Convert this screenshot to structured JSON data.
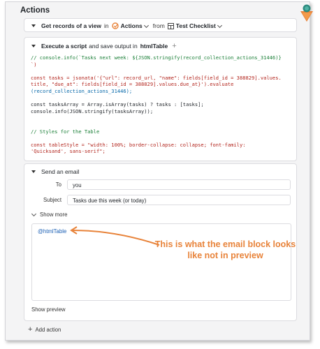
{
  "section_title": "Actions",
  "get_records": {
    "prefix": "Get records of a view",
    "in": "in",
    "view": "Actions",
    "from": "from",
    "table": "Test Checklist"
  },
  "execute_script": {
    "prefix": "Execute a script",
    "middle": "and save output in",
    "output": "htmlTable",
    "add": "+"
  },
  "code": {
    "lines": [
      "// console.info(`Tasks next week: ${JSON.stringify(record_collection_actions_31446)}",
      "`)",
      "",
      "const tasks = jsonata('{\"url\": record_url, \"name\": fields[field_id = 388829].values.",
      "title, \"due_at\": fields[field_id = 388829].values.due_at}').evaluate",
      "(record_collection_actions_31446);",
      "",
      "const tasksArray = Array.isArray(tasks) ? tasks : [tasks];",
      "console.info(JSON.stringify(tasksArray));",
      "",
      "",
      "// Styles for the Table",
      "",
      "const tableStyle = \"width: 100%; border-collapse: collapse; font-family:",
      "'Quicksand', sans-serif\";"
    ]
  },
  "send_email": {
    "title": "Send an email",
    "to_label": "To",
    "to_value": "you",
    "subject_label": "Subject",
    "subject_value": "Tasks due this week (or today)",
    "show_more": "Show more",
    "body_token": "@htmlTable",
    "show_preview": "Show preview"
  },
  "annotation": {
    "line1": "This is what the email block looks",
    "line2": "like not in preview",
    "color": "#e8833a"
  },
  "add_action": "Add action",
  "add_icon": "+"
}
